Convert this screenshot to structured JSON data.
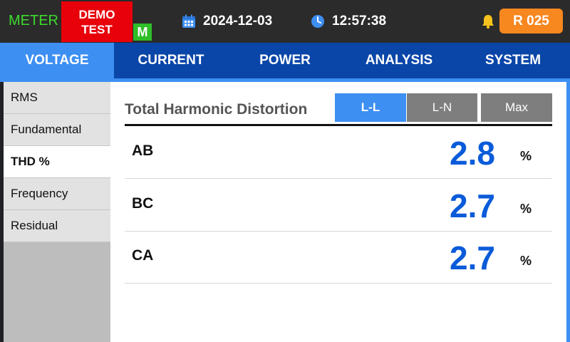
{
  "header": {
    "meter_label": "METER",
    "demo_line1": "DEMO",
    "demo_line2": "TEST",
    "mode_badge": "M",
    "date": "2024-12-03",
    "time": "12:57:38",
    "register_badge": "R 025",
    "icons": [
      "calendar-icon",
      "clock-icon",
      "bell-icon"
    ]
  },
  "tabs": [
    {
      "label": "VOLTAGE",
      "active": true
    },
    {
      "label": "CURRENT"
    },
    {
      "label": "POWER"
    },
    {
      "label": "ANALYSIS"
    },
    {
      "label": "SYSTEM"
    }
  ],
  "sidebar": {
    "items": [
      {
        "label": "RMS"
      },
      {
        "label": "Fundamental"
      },
      {
        "label": "THD %",
        "active": true
      },
      {
        "label": "Frequency"
      },
      {
        "label": "Residual"
      }
    ]
  },
  "main": {
    "title": "Total Harmonic Distortion",
    "segments": [
      {
        "label": "L-L",
        "active": true
      },
      {
        "label": "L-N"
      },
      {
        "label": "Max"
      }
    ],
    "rows": [
      {
        "label": "AB",
        "value": "2.8",
        "unit": "%"
      },
      {
        "label": "BC",
        "value": "2.7",
        "unit": "%"
      },
      {
        "label": "CA",
        "value": "2.7",
        "unit": "%"
      }
    ]
  },
  "colors": {
    "accent_blue": "#3d8ff2",
    "tab_bar": "#0a46a8",
    "value_blue": "#0a5bd9",
    "demo_red": "#e8000a",
    "meter_green": "#3ddc2c",
    "badge_orange": "#f7871f"
  }
}
